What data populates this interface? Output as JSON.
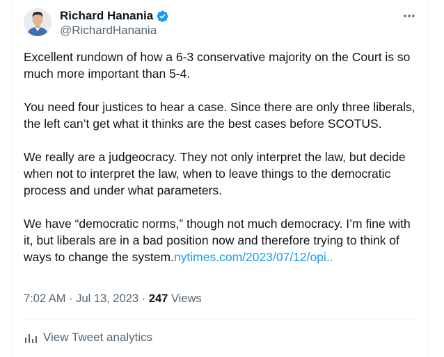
{
  "author": {
    "display_name": "Richard Hanania",
    "handle": "@RichardHanania",
    "verified": true
  },
  "more_icon": "more-horizontal-icon",
  "tweet": {
    "paragraphs": [
      {
        "text": "Excellent rundown of how a 6-3 conservative majority on the Court is so much more important than 5-4."
      },
      {
        "text": "You need four justices to hear a case. Since there are only three liberals, the left can’t get what it thinks are the best cases before SCOTUS."
      },
      {
        "text": "We really are a judgeocracy. They not only interpret the law, but decide when not to interpret the law, when to leave things to the democratic process and under what parameters."
      },
      {
        "text": "We have “democratic norms,” though not much democracy. I’m fine with it, but liberals are in a bad position now and therefore trying to think of ways to change the system.",
        "link": "nytimes.com/2023/07/12/opi.."
      }
    ]
  },
  "meta": {
    "time": "7:02 AM",
    "separator": "·",
    "date": "Jul 13, 2023",
    "views_count": "247",
    "views_label": "Views"
  },
  "analytics": {
    "label": "View Tweet analytics",
    "icon": "bar-chart-icon"
  },
  "colors": {
    "text": "#0f1419",
    "secondary": "#536471",
    "link": "#1d9bf0",
    "verified": "#1d9bf0",
    "divider": "#eff3f4"
  }
}
